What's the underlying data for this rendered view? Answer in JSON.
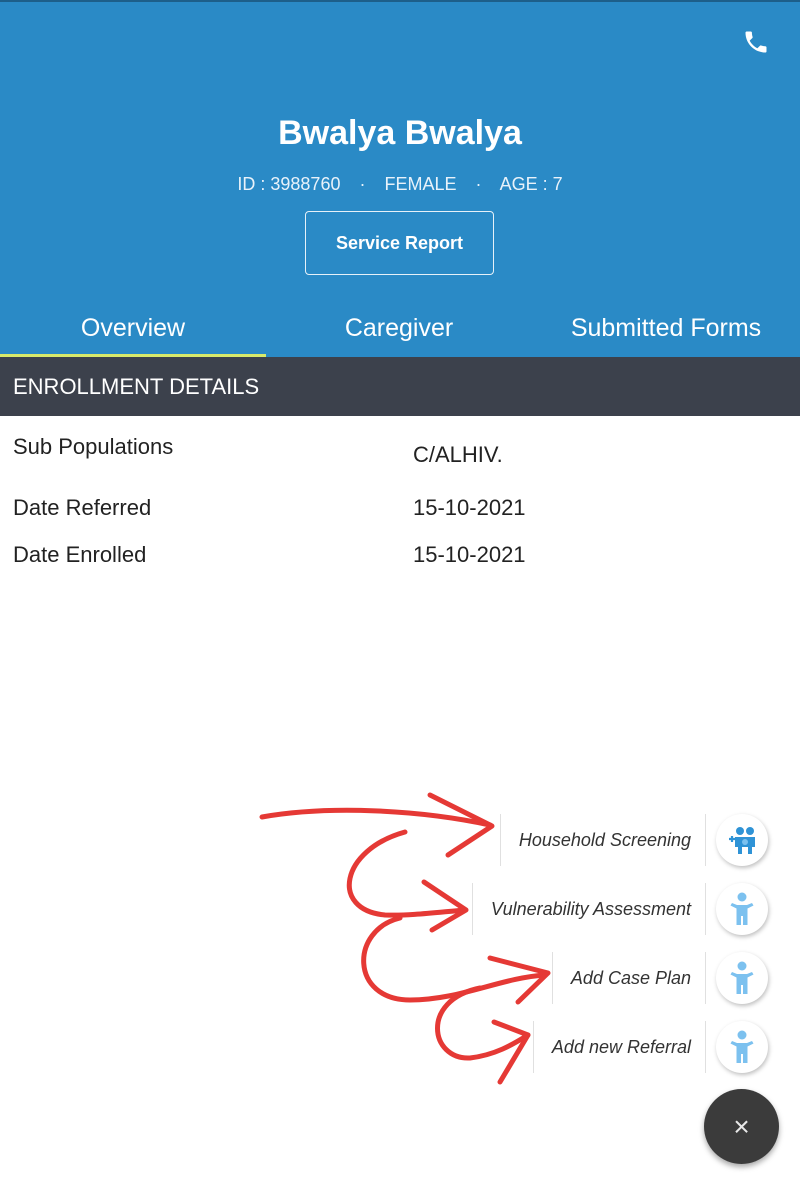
{
  "patient": {
    "name": "Bwalya Bwalya",
    "id_text": "ID : 3988760",
    "sex": "FEMALE",
    "age_text": "AGE : 7",
    "separator": "·"
  },
  "header": {
    "service_report_label": "Service Report",
    "phone_icon": "phone-icon"
  },
  "tabs": [
    {
      "label": "Overview",
      "active": true
    },
    {
      "label": "Caregiver",
      "active": false
    },
    {
      "label": "Submitted Forms",
      "active": false
    }
  ],
  "enrollment": {
    "title": "ENROLLMENT DETAILS",
    "rows": [
      {
        "label": "Sub Populations",
        "value": "C/ALHIV."
      },
      {
        "label": "Date Referred",
        "value": "15-10-2021"
      },
      {
        "label": "Date Enrolled",
        "value": "15-10-2021"
      }
    ]
  },
  "fab_menu": {
    "items": [
      {
        "label": "Household Screening",
        "icon": "family-icon"
      },
      {
        "label": "Vulnerability Assessment",
        "icon": "child-icon"
      },
      {
        "label": "Add Case Plan",
        "icon": "child-icon"
      },
      {
        "label": "Add new Referral",
        "icon": "child-icon"
      }
    ],
    "close_label": "×"
  },
  "colors": {
    "header_bg": "#2a8ac6",
    "tab_indicator": "#d8ea6b",
    "section_bg": "#3c414c",
    "icon_blue": "#7cc1ef",
    "annotation_red": "#e53935"
  }
}
